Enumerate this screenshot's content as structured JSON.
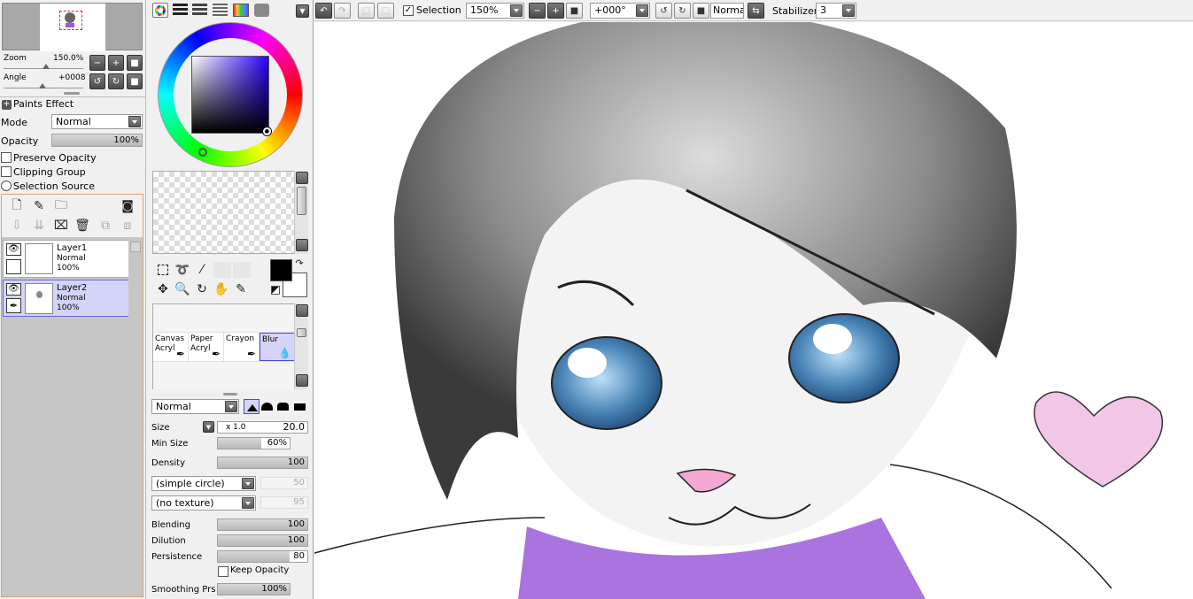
{
  "navigator": {
    "zoom_label": "Zoom",
    "zoom_value": "150.0%",
    "angle_label": "Angle",
    "angle_value": "+0008"
  },
  "layer_props": {
    "paints_effect": "Paints Effect",
    "mode_label": "Mode",
    "mode_value": "Normal",
    "opacity_label": "Opacity",
    "opacity_value": "100%",
    "opacity_level": 1.0,
    "preserve_opacity": "Preserve Opacity",
    "clipping_group": "Clipping Group",
    "selection_source": "Selection Source"
  },
  "layers": [
    {
      "name": "Layer1",
      "mode": "Normal",
      "opacity": "100%",
      "selected": false
    },
    {
      "name": "Layer2",
      "mode": "Normal",
      "opacity": "100%",
      "selected": true
    }
  ],
  "colors": {
    "primary": "#000000",
    "secondary": "#ffffff",
    "hue_square": "#2a00ff",
    "selection_highlight": "#d4d4f8",
    "hair": "#4a4a4a",
    "eyes": "#4a86b8",
    "scarf": "#9b5ad9",
    "heart": "#f2c6e6"
  },
  "brushes": [
    {
      "line1": "Canvas",
      "line2": "Acryl"
    },
    {
      "line1": "Paper",
      "line2": "Acryl"
    },
    {
      "line1": "Crayon",
      "line2": ""
    },
    {
      "line1": "Blur",
      "line2": ""
    }
  ],
  "tool_settings": {
    "blend_mode": "Normal",
    "size_label": "Size",
    "size_mult": "x 1.0",
    "size_value": "20.0",
    "min_size_label": "Min Size",
    "min_size_value": "60%",
    "min_size_level": 0.6,
    "density_label": "Density",
    "density_value": "100",
    "density_level": 1.0,
    "shape": "(simple circle)",
    "shape_value": "50",
    "texture": "(no texture)",
    "texture_value": "95",
    "blending_label": "Blending",
    "blending_value": "100",
    "blending_level": 1.0,
    "dilution_label": "Dilution",
    "dilution_value": "100",
    "dilution_level": 1.0,
    "persistence_label": "Persistence",
    "persistence_value": "80",
    "persistence_level": 0.8,
    "keep_opacity": "Keep Opacity",
    "smoothing_label": "Smoothing Prs",
    "smoothing_value": "100%",
    "smoothing_level": 1.0
  },
  "toolbar": {
    "selection_label": "Selection",
    "zoom_value": "150%",
    "angle_value": "+000°",
    "blend_mode": "Normal",
    "stabilizer_label": "Stabilizer",
    "stabilizer_value": "3"
  }
}
